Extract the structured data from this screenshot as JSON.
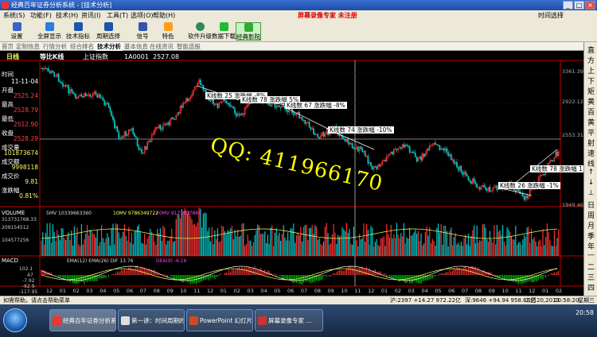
{
  "window": {
    "title": "经典百年证券分析系统 - [技术分析]"
  },
  "menu": {
    "items": [
      "系统(S)",
      "功能(F)",
      "技术(H)",
      "资讯(I)",
      "工具(T)",
      "选项(O)",
      "帮助(H)"
    ],
    "promo": "屏幕录像专家 未注册",
    "right": "时间选择"
  },
  "toolbar": {
    "buttons": [
      "设置",
      "全屏显示",
      "技术指标",
      "周期选择",
      "信号",
      "特色",
      "软件升级",
      "数据下载",
      "经典影院"
    ]
  },
  "tabs": [
    "首页",
    "定制信息",
    "行情分析",
    "综合排名",
    "技术分析",
    "基本信息",
    "在线资讯",
    "智能选股"
  ],
  "chart": {
    "period_label": "日线",
    "type_label": "等比K线",
    "index_name": "上证指数",
    "index_code": "1A0001",
    "index_value": "2527.08"
  },
  "info": {
    "time_label": "时间",
    "date": "11-11-04",
    "open_label": "开盘",
    "open": "2525.24",
    "high_label": "最高",
    "high": "2528.79",
    "low_label": "最低",
    "low": "2512.90",
    "close_label": "收盘",
    "close": "2528.29",
    "volume_label": "成交量",
    "volume": "101873674",
    "amount_label": "成交额",
    "amount": "9998118",
    "change_label": "成交价",
    "change": "9.81",
    "pct_label": "涨跌幅",
    "pct": "0.81%"
  },
  "price_axis": [
    "3361.39",
    "2922.12",
    "2553.31",
    "1949.46"
  ],
  "annotations": [
    "K线数 25 涨跌幅 -8%",
    "K线数 78 涨跌幅 5%",
    "K线数 67 涨跌幅 -8%",
    "K线数 74 涨跌幅 -10%",
    "K线数 78 涨跌幅 1",
    "K线数 26 涨跌幅 -1%"
  ],
  "volume_panel": {
    "label": "VOLUME",
    "ma5": "5MV 10339663360",
    "ma10": "10MV 9786349722",
    "ma20": "20MV 9171937864",
    "axis": [
      "313731768.33",
      "209154512",
      "104577256"
    ]
  },
  "macd_panel": {
    "label": "MACD",
    "params": "EMA(12) EMA(26) DIF 13.76",
    "dea": "DEA(9) -6.16",
    "axis": [
      "102.1",
      "47",
      "-7.92",
      "-62.9",
      "-117.95"
    ]
  },
  "x_axis": [
    "12",
    "01",
    "02",
    "03",
    "04",
    "05",
    "06",
    "07",
    "08",
    "09",
    "10",
    "11",
    "12",
    "01",
    "02",
    "03",
    "04",
    "05",
    "06",
    "07",
    "08",
    "09",
    "10",
    "11",
    "12",
    "01",
    "02",
    "03",
    "04",
    "05",
    "06",
    "07",
    "08",
    "09",
    "10",
    "11",
    "12",
    "01",
    "02"
  ],
  "right_tools": [
    "直",
    "方",
    "上",
    "下",
    "矩",
    "黄",
    "百",
    "黄",
    "平",
    "射",
    "速",
    "线",
    "↑",
    "↓",
    "⊥",
    "日",
    "周",
    "月",
    "季",
    "年",
    "—",
    "二",
    "三",
    "四"
  ],
  "watermark": "QQ: 411966170",
  "status": {
    "hint": "如需帮助，请点击帮助菜单",
    "sh": "沪:2397 +14.27 972.22亿",
    "sz": "深:9646 +94.94 958.68亿",
    "date": "二月20,2013",
    "time": "20:58:20",
    "mode": "星期三"
  },
  "taskbar": {
    "tasks": [
      "经典百年证券分析系...",
      "第一讲：时间周期的...",
      "PowerPoint 幻灯片...",
      "屏幕录像专家 ..."
    ],
    "clock": "20:58"
  },
  "colors": {
    "up": "#ff3333",
    "down": "#00c8c8",
    "axis": "#c00000",
    "annot": "#ffffff"
  }
}
